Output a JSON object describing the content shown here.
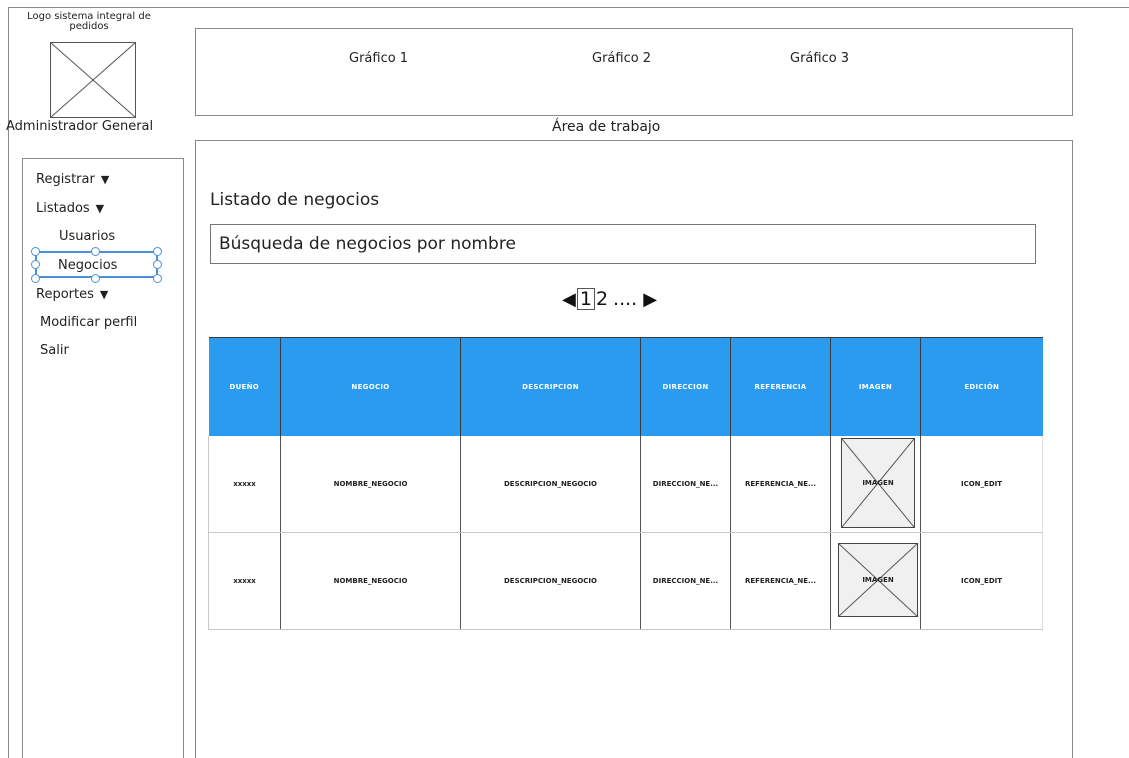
{
  "logo": {
    "text": "Logo sistema integral de pedidos"
  },
  "user": {
    "role": "Administrador General"
  },
  "charts": [
    "Gráfico 1",
    "Gráfico 2",
    "Gráfico 3"
  ],
  "workarea": {
    "label": "Área de trabajo"
  },
  "sidebar": {
    "registrar": "Registrar",
    "listados": "Listados",
    "usuarios": "Usuarios",
    "negocios": "Negocios",
    "reportes": "Reportes",
    "modificar": "Modificar perfil",
    "salir": "Salir",
    "caret": "▼"
  },
  "main": {
    "title": "Listado de negocios",
    "search_value": "Búsqueda de negocios por nombre"
  },
  "pagination": {
    "prev": "◀",
    "current": "1",
    "next_page": "2",
    "ellipsis": "....",
    "next": "▶"
  },
  "table": {
    "headers": [
      "DUEÑO",
      "NEGOCIO",
      "DESCRIPCION",
      "DIRECCION",
      "REFERENCIA",
      "IMAGEN",
      "EDICIÓN"
    ],
    "rows": [
      [
        "xxxxx",
        "NOMBRE_NEGOCIO",
        "DESCRIPCION_NEGOCIO",
        "DIRECCION_NE...",
        "REFERENCIA_NE...",
        "IMAGEN",
        "ICON_EDIT"
      ],
      [
        "xxxxx",
        "NOMBRE_NEGOCIO",
        "DESCRIPCION_NEGOCIO",
        "DIRECCION_NE...",
        "REFERENCIA_NE...",
        "IMAGEN",
        "ICON_EDIT"
      ]
    ]
  },
  "colors": {
    "header_bg": "#2b9bf0",
    "selection": "#4a90d9"
  }
}
